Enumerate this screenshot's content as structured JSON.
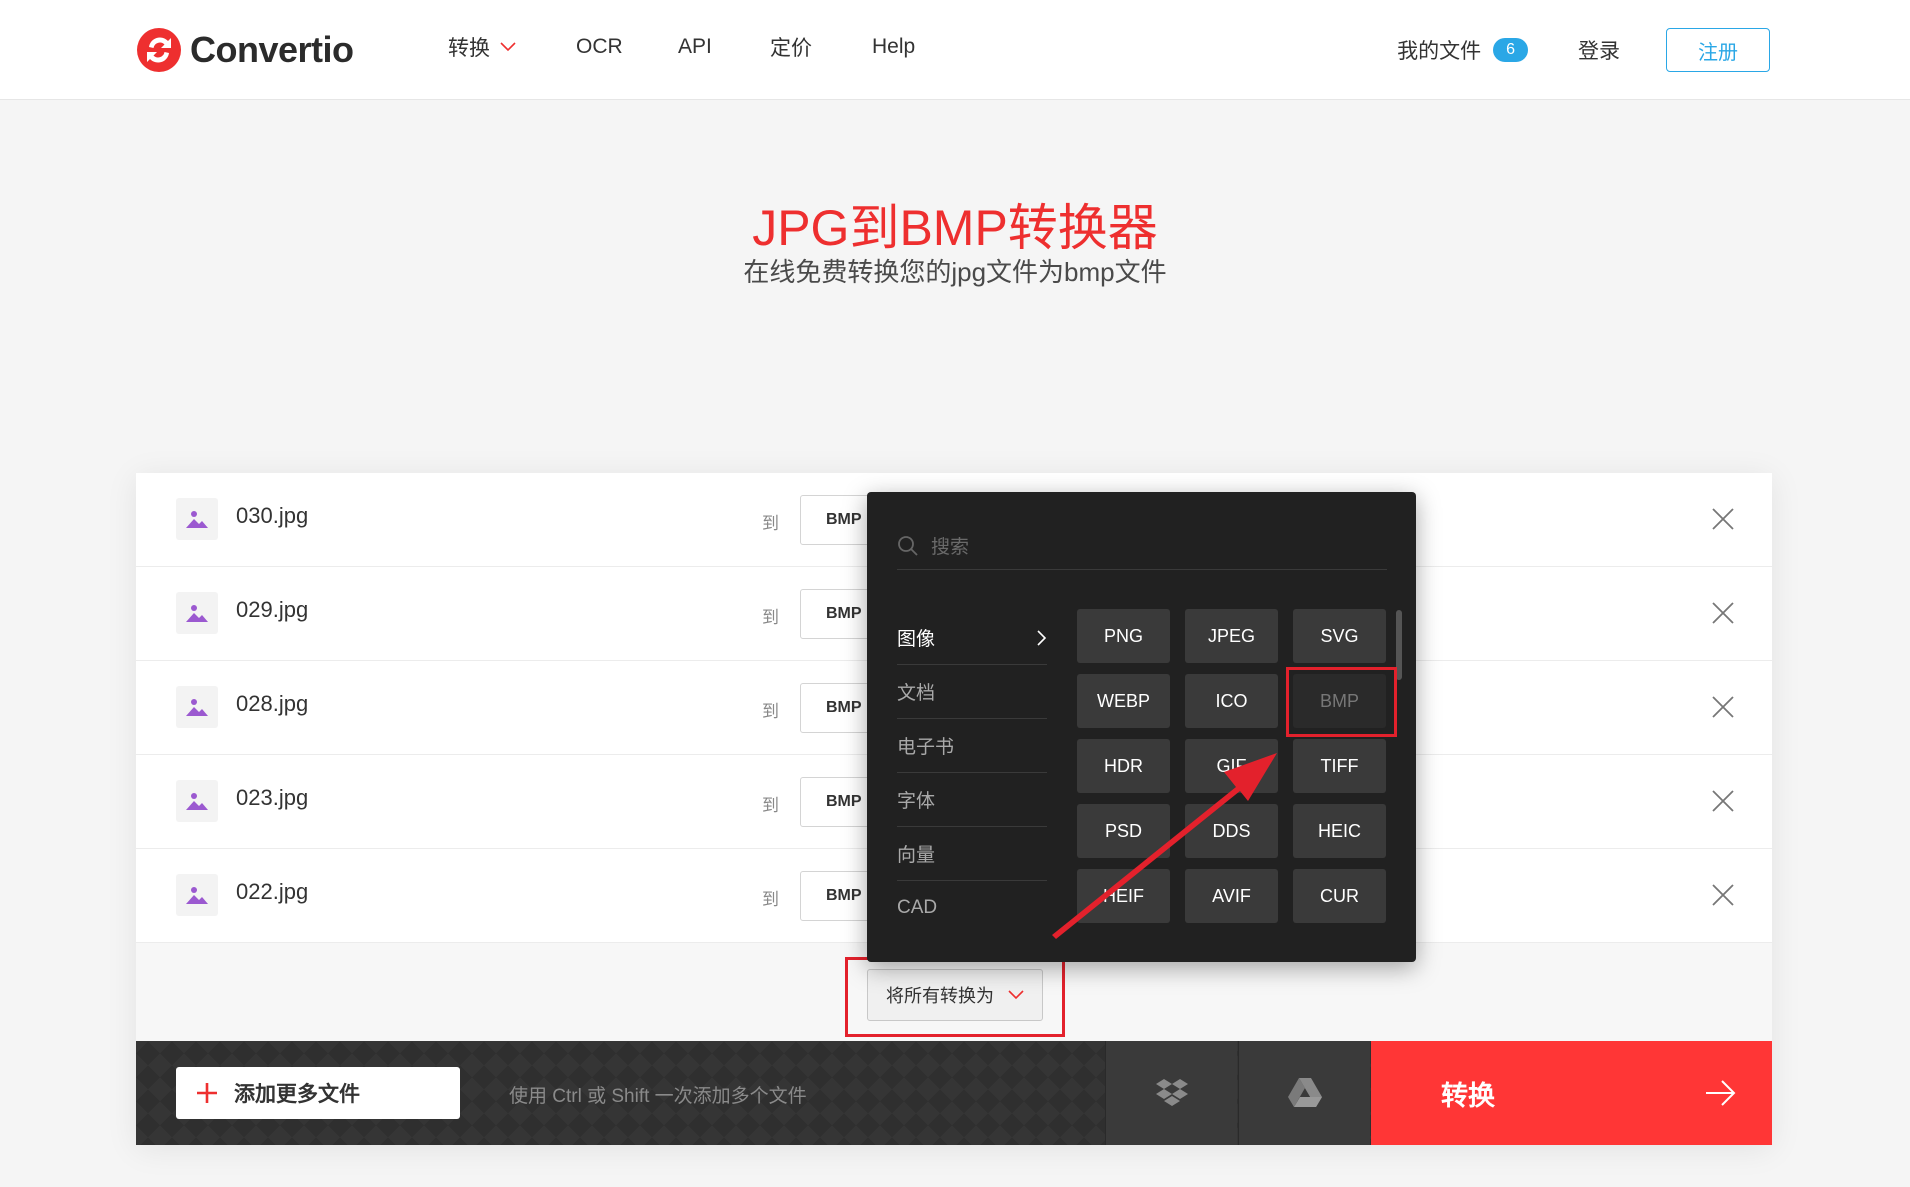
{
  "header": {
    "logo_text": "Convertio",
    "nav": [
      {
        "label": "转换"
      },
      {
        "label": "OCR"
      },
      {
        "label": "API"
      },
      {
        "label": "定价"
      },
      {
        "label": "Help"
      }
    ],
    "my_files_label": "我的文件",
    "my_files_count": "6",
    "login_label": "登录",
    "signup_label": "注册"
  },
  "hero": {
    "title": "JPG到BMP转换器",
    "subtitle": "在线免费转换您的jpg文件为bmp文件"
  },
  "files": [
    {
      "name": "030.jpg",
      "to": "到",
      "format": "BMP"
    },
    {
      "name": "029.jpg",
      "to": "到",
      "format": "BMP"
    },
    {
      "name": "028.jpg",
      "to": "到",
      "format": "BMP"
    },
    {
      "name": "023.jpg",
      "to": "到",
      "format": "BMP"
    },
    {
      "name": "022.jpg",
      "to": "到",
      "format": "BMP"
    }
  ],
  "convert_all_label": "将所有转换为",
  "dropdown": {
    "search_placeholder": "搜索",
    "categories": [
      "图像",
      "文档",
      "电子书",
      "字体",
      "向量",
      "CAD"
    ],
    "formats": [
      "PNG",
      "JPEG",
      "SVG",
      "WEBP",
      "ICO",
      "BMP",
      "HDR",
      "GIF",
      "TIFF",
      "PSD",
      "DDS",
      "HEIC",
      "HEIF",
      "AVIF",
      "CUR"
    ],
    "selected_format": "BMP"
  },
  "bottom": {
    "add_more_label": "添加更多文件",
    "hint": "使用 Ctrl 或 Shift 一次添加多个文件",
    "convert_label": "转换"
  },
  "colors": {
    "accent_red": "#ff3636",
    "title_red": "#ee2f2f",
    "link_blue": "#2aa7e6",
    "annotation_red": "#e3212c"
  }
}
